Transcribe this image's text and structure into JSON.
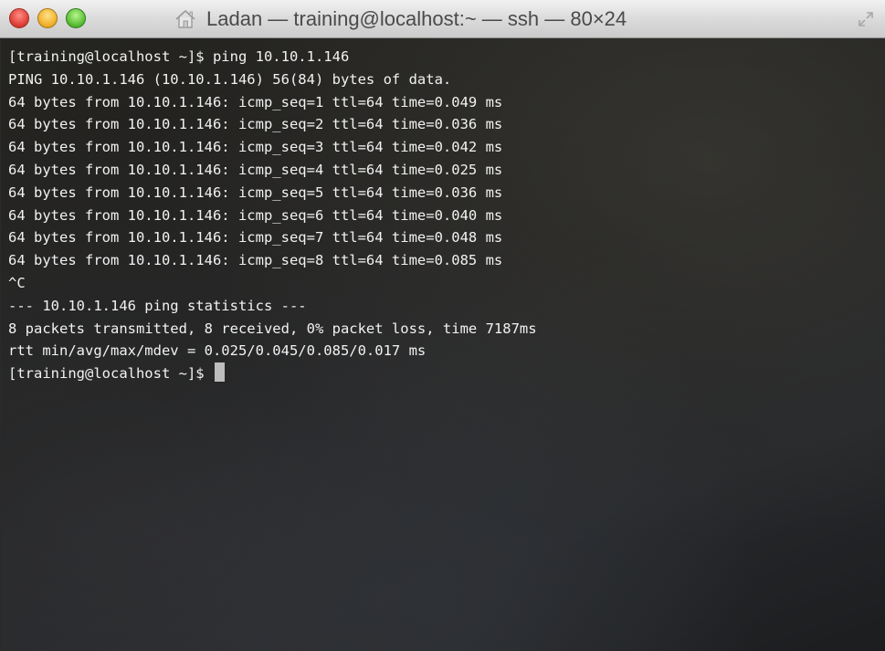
{
  "window": {
    "title": "Ladan — training@localhost:~ — ssh — 80×24"
  },
  "icons": {
    "title_icon": "home-icon",
    "resize": "fullscreen-resize-icon",
    "close": "close-button",
    "minimize": "minimize-button",
    "maximize": "zoom-button"
  },
  "colors": {
    "close": "#e0443a",
    "minimize": "#f2b431",
    "maximize": "#5fc13a",
    "terminal_text": "#f2f2f2",
    "terminal_bg": "#222221"
  },
  "terminal": {
    "lines": [
      "[training@localhost ~]$ ping 10.10.1.146",
      "PING 10.10.1.146 (10.10.1.146) 56(84) bytes of data.",
      "64 bytes from 10.10.1.146: icmp_seq=1 ttl=64 time=0.049 ms",
      "64 bytes from 10.10.1.146: icmp_seq=2 ttl=64 time=0.036 ms",
      "64 bytes from 10.10.1.146: icmp_seq=3 ttl=64 time=0.042 ms",
      "64 bytes from 10.10.1.146: icmp_seq=4 ttl=64 time=0.025 ms",
      "64 bytes from 10.10.1.146: icmp_seq=5 ttl=64 time=0.036 ms",
      "64 bytes from 10.10.1.146: icmp_seq=6 ttl=64 time=0.040 ms",
      "64 bytes from 10.10.1.146: icmp_seq=7 ttl=64 time=0.048 ms",
      "64 bytes from 10.10.1.146: icmp_seq=8 ttl=64 time=0.085 ms",
      "^C",
      "--- 10.10.1.146 ping statistics ---",
      "8 packets transmitted, 8 received, 0% packet loss, time 7187ms",
      "rtt min/avg/max/mdev = 0.025/0.045/0.085/0.017 ms"
    ],
    "prompt": "[training@localhost ~]$ "
  }
}
